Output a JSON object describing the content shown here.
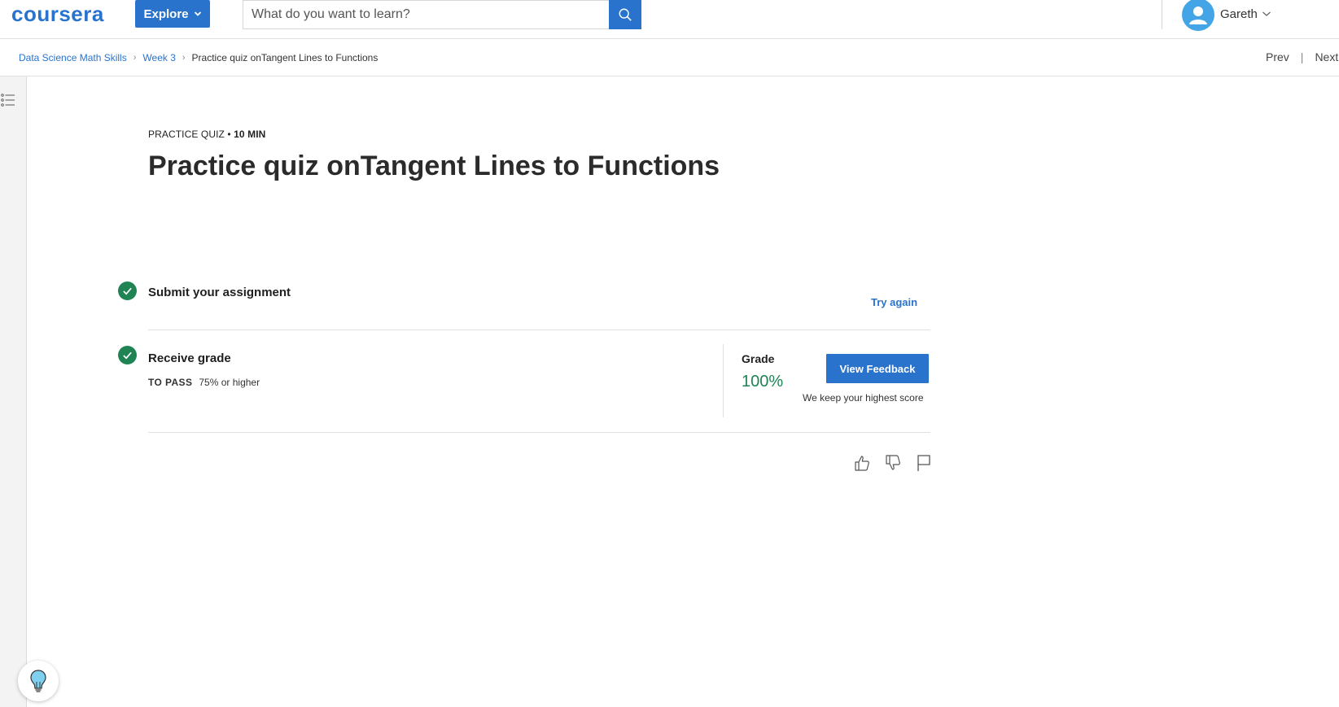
{
  "header": {
    "logo_text": "coursera",
    "explore_label": "Explore",
    "search_placeholder": "What do you want to learn?",
    "user_name": "Gareth"
  },
  "breadcrumb": {
    "items": [
      "Data Science Math Skills",
      "Week 3"
    ],
    "current": "Practice quiz onTangent Lines to Functions",
    "separator": "›"
  },
  "nav": {
    "prev_label": "Prev",
    "separator": "|",
    "next_label": "Next"
  },
  "quiz": {
    "type_label": "PRACTICE QUIZ",
    "duration": "10 MIN",
    "title": "Practice quiz onTangent Lines to Functions"
  },
  "steps": {
    "submit_label": "Submit your assignment",
    "try_again_label": "Try again",
    "receive_label": "Receive grade",
    "pass_label": "TO PASS",
    "pass_value": "75% or higher"
  },
  "grade": {
    "label": "Grade",
    "value": "100%",
    "view_feedback_label": "View Feedback",
    "note": "We keep your highest score"
  },
  "colors": {
    "brand_blue": "#2a73cc",
    "success_green": "#1f8354",
    "avatar_blue": "#43a4e6"
  },
  "icons": {
    "search": "search-icon",
    "user": "user-icon",
    "outline": "outline-list-icon",
    "check": "check-icon",
    "like": "thumbs-up-icon",
    "dislike": "thumbs-down-icon",
    "flag": "flag-icon",
    "hint": "lightbulb-icon"
  }
}
